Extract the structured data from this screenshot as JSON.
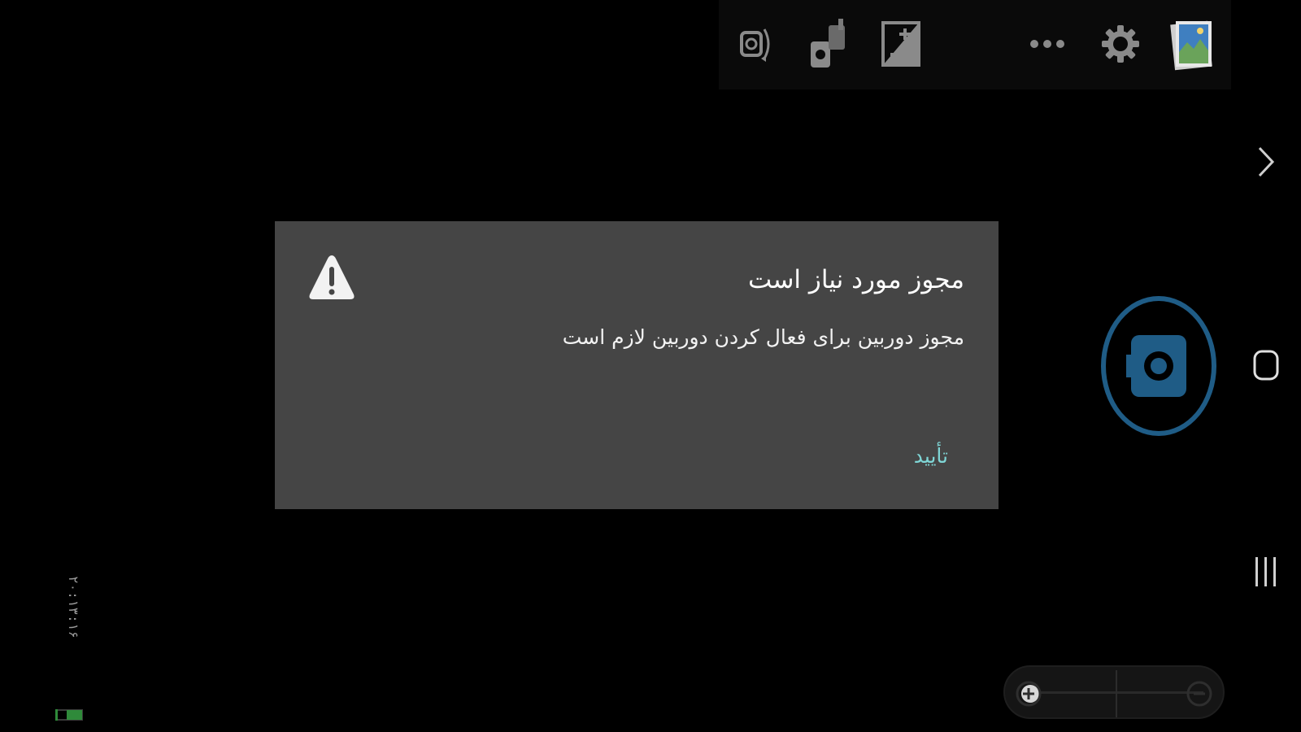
{
  "dialog": {
    "title": "مجوز مورد نیاز است",
    "message": "مجوز دوربین برای فعال کردن دوربین لازم است",
    "ok_label": "تأیید"
  },
  "toolbar": {
    "icons": [
      "camera-switch-icon",
      "multi-camera-icon",
      "exposure-icon",
      "more-icon",
      "settings-icon",
      "gallery-icon"
    ]
  },
  "status": {
    "timestamp": "۲۰:۱۳:۱۶"
  },
  "colors": {
    "dialog_bg": "#454545",
    "accent": "#7fd6d6",
    "shutter_ring": "#1f5c86"
  }
}
